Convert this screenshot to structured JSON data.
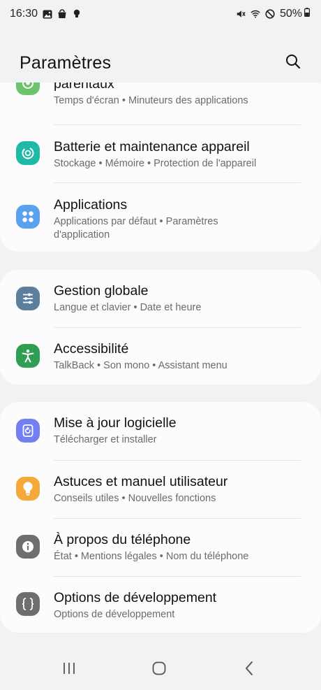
{
  "status_bar": {
    "time": "16:30",
    "battery": "50%"
  },
  "header": {
    "title": "Paramètres"
  },
  "items": [
    {
      "title": "parentaux",
      "subtitle": "Temps d'écran  •  Minuteurs des applications",
      "icon": "parental-controls-icon",
      "color": "#6cc36b"
    },
    {
      "title": "Batterie et maintenance appareil",
      "subtitle": "Stockage  •  Mémoire  •  Protection de l'appareil",
      "icon": "device-care-icon",
      "color": "#1fb9a5"
    },
    {
      "title": "Applications",
      "subtitle": "Applications par défaut  •  Paramètres d'application",
      "icon": "apps-icon",
      "color": "#5aa2f0"
    },
    {
      "title": "Gestion globale",
      "subtitle": "Langue et clavier  •  Date et heure",
      "icon": "general-management-icon",
      "color": "#5e7f9c"
    },
    {
      "title": "Accessibilité",
      "subtitle": "TalkBack  •  Son mono  •  Assistant menu",
      "icon": "accessibility-icon",
      "color": "#2f9e52"
    },
    {
      "title": "Mise à jour logicielle",
      "subtitle": "Télécharger et installer",
      "icon": "software-update-icon",
      "color": "#7180f0"
    },
    {
      "title": "Astuces et manuel utilisateur",
      "subtitle": "Conseils utiles  •  Nouvelles fonctions",
      "icon": "tips-icon",
      "color": "#f6a93b"
    },
    {
      "title": "À propos du téléphone",
      "subtitle": "État  •  Mentions légales  •  Nom du téléphone",
      "icon": "about-phone-icon",
      "color": "#6e6e6e"
    },
    {
      "title": "Options de développement",
      "subtitle": "Options de développement",
      "icon": "developer-options-icon",
      "color": "#6e6e6e"
    }
  ]
}
